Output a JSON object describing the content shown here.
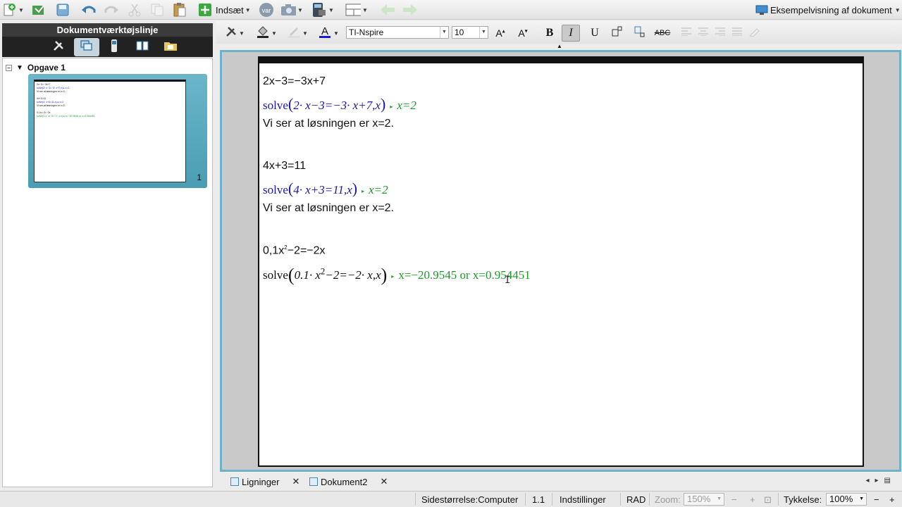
{
  "toolbar": {
    "insert_label": "Indsæt",
    "var_label": "var",
    "preview_label": "Eksempelvisning af dokument",
    "icons": [
      "new-doc-icon",
      "open-icon",
      "save-icon",
      "undo-icon",
      "redo-icon",
      "cut-icon",
      "copy-icon",
      "paste-icon",
      "insert-icon",
      "var-icon",
      "screenshot-icon",
      "calculator-icon",
      "page-layout-icon",
      "back-icon",
      "forward-icon",
      "preview-icon"
    ]
  },
  "left_panel": {
    "title": "Dokumentværktøjslinje",
    "problem_label": "Opgave 1",
    "page_number": "1",
    "thumb_lines": [
      "2x−3=−3x+7",
      "solve(2· x−3=−3· x+7,x) ▸ x=2",
      "Vi ser at løsningen er x=2.",
      "",
      "4x+3=11",
      "solve(4· x+3=11,x) ▸ x=2",
      "Vi ser at løsningen er x=2.",
      "",
      "0,1x²−2=−2x",
      "solve(0.1· x²−2=−2· x,x) ▸ x=−20.9545 or x=0.954451"
    ]
  },
  "format": {
    "font": "TI-Nspire",
    "size": "10",
    "bold": "B",
    "italic": "I",
    "underline": "U",
    "strike": "ABC"
  },
  "document": {
    "l1": "2x−3=−3x+7",
    "l2_cmd": "solve",
    "l2_args": "2· x−3=−3· x+7,x",
    "l2_result": "x=2",
    "l3": "Vi ser at løsningen er x=2.",
    "l4": "4x+3=11",
    "l5_cmd": "solve",
    "l5_args": "4· x+3=11,x",
    "l5_result": "x=2",
    "l6": "Vi ser at løsningen er x=2.",
    "l7_a": "0,1x",
    "l7_sup": "2",
    "l7_b": "−2=−2x",
    "l8_cmd": "solve",
    "l8_a": "0.1· x",
    "l8_sup": "2",
    "l8_b": "−2=−2· x,x",
    "l8_result": "x=−20.9545 or x=0.954451"
  },
  "tabs": [
    {
      "label": "Ligninger"
    },
    {
      "label": "Dokument2"
    }
  ],
  "status": {
    "page_size": "Sidestørrelse:Computer",
    "page_num": "1.1",
    "settings": "Indstillinger",
    "angle": "RAD",
    "zoom_label": "Zoom:",
    "zoom_value": "150%",
    "thickness_label": "Tykkelse:",
    "thickness_value": "100%"
  },
  "colors": {
    "frame": "#6fb2c8",
    "blue_text": "#1a1aa8",
    "green_text": "#1f9a2a"
  }
}
